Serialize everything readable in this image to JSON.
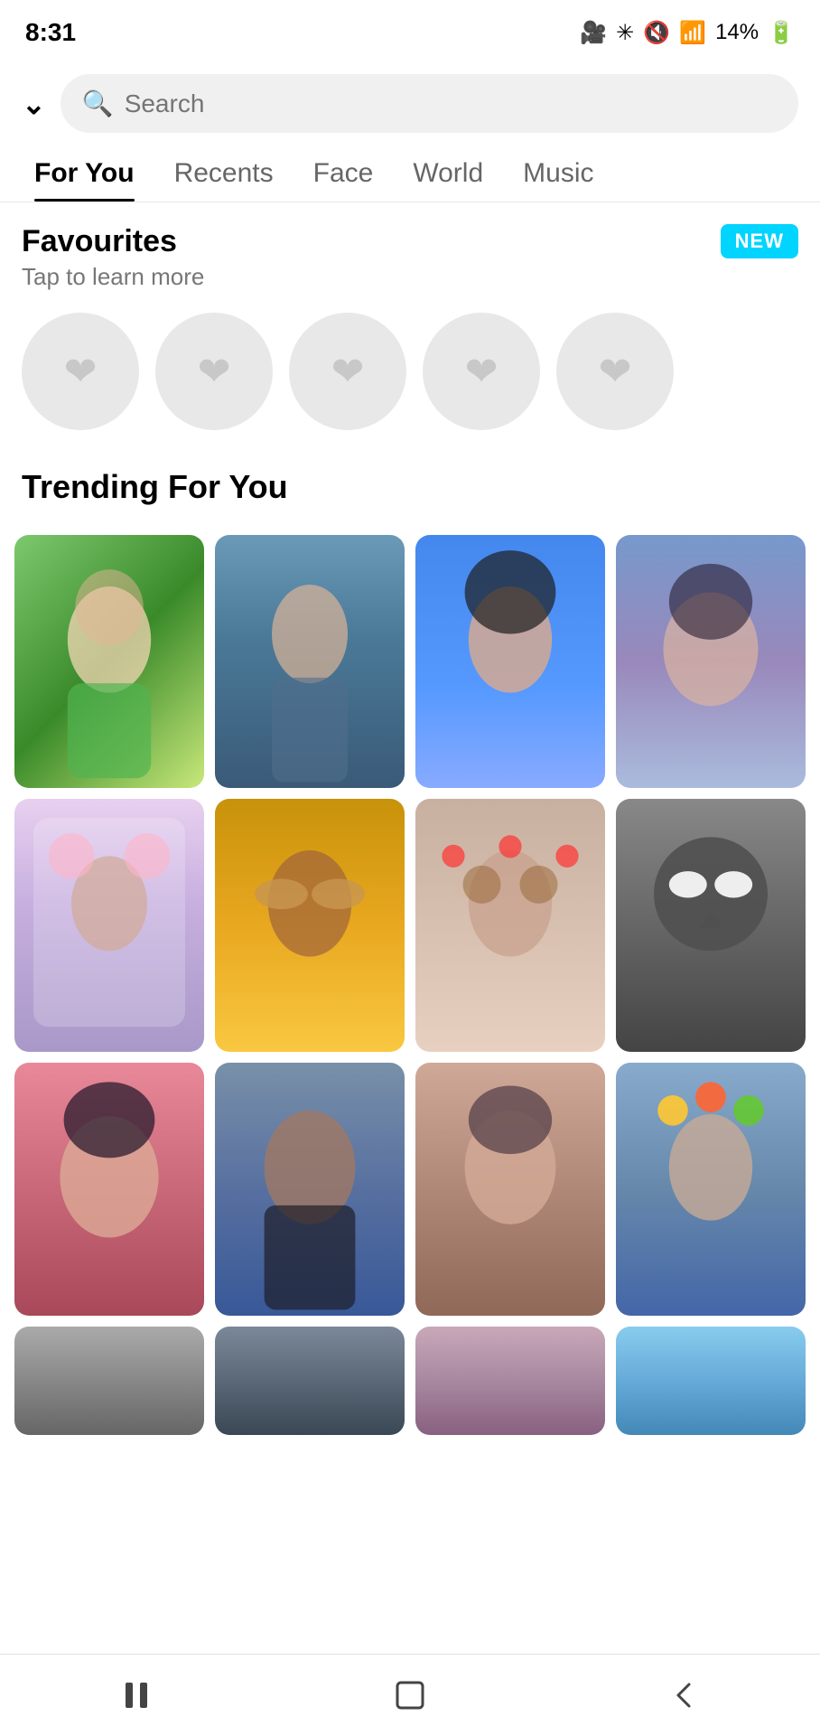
{
  "statusBar": {
    "time": "8:31",
    "icons": "🎥  ✳  🔇  📶  14%"
  },
  "searchBar": {
    "placeholder": "Search",
    "dropdownIcon": "❯"
  },
  "tabs": [
    {
      "id": "for-you",
      "label": "For You",
      "active": true
    },
    {
      "id": "recents",
      "label": "Recents",
      "active": false
    },
    {
      "id": "face",
      "label": "Face",
      "active": false
    },
    {
      "id": "world",
      "label": "World",
      "active": false
    },
    {
      "id": "music",
      "label": "Music",
      "active": false
    }
  ],
  "favourites": {
    "title": "Favourites",
    "subtitle": "Tap to learn more",
    "newBadge": "NEW",
    "circles": [
      1,
      2,
      3,
      4,
      5
    ]
  },
  "trending": {
    "title": "Trending For You"
  },
  "gridRows": [
    [
      {
        "id": 1,
        "colorClass": "img-1"
      },
      {
        "id": 2,
        "colorClass": "img-2"
      },
      {
        "id": 3,
        "colorClass": "img-3"
      },
      {
        "id": 4,
        "colorClass": "img-4"
      }
    ],
    [
      {
        "id": 5,
        "colorClass": "img-5"
      },
      {
        "id": 6,
        "colorClass": "img-6"
      },
      {
        "id": 7,
        "colorClass": "img-7"
      },
      {
        "id": 8,
        "colorClass": "img-8"
      }
    ],
    [
      {
        "id": 9,
        "colorClass": "img-9"
      },
      {
        "id": 10,
        "colorClass": "img-10"
      },
      {
        "id": 11,
        "colorClass": "img-11"
      },
      {
        "id": 12,
        "colorClass": "img-12"
      }
    ],
    [
      {
        "id": 13,
        "colorClass": "img-13"
      },
      {
        "id": 14,
        "colorClass": "img-14"
      },
      {
        "id": 15,
        "colorClass": "img-15"
      },
      {
        "id": 16,
        "colorClass": "img-16"
      }
    ]
  ],
  "bottomNav": {
    "pauseIcon": "⏸",
    "homeIcon": "⬜",
    "backIcon": "❮"
  }
}
